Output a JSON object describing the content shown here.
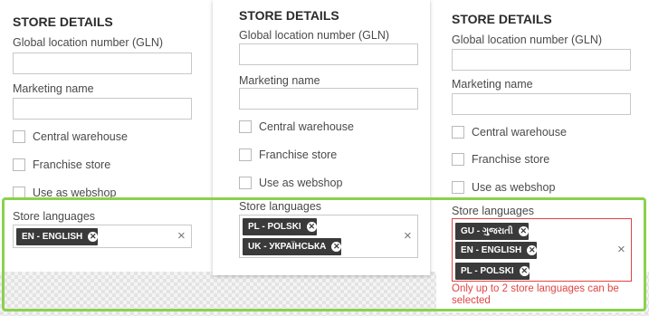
{
  "panels": [
    {
      "title": "STORE DETAILS",
      "gln_label": "Global location number (GLN)",
      "gln_value": "",
      "marketing_label": "Marketing name",
      "marketing_value": "",
      "checkboxes": [
        "Central warehouse",
        "Franchise store",
        "Use as webshop"
      ],
      "languages_label": "Store languages",
      "tags": [
        "EN - ENGLISH"
      ],
      "clear_icon": "×"
    },
    {
      "title": "STORE DETAILS",
      "gln_label": "Global location number (GLN)",
      "gln_value": "",
      "marketing_label": "Marketing name",
      "marketing_value": "",
      "checkboxes": [
        "Central warehouse",
        "Franchise store",
        "Use as webshop"
      ],
      "languages_label": "Store languages",
      "tags": [
        "PL - POLSKI",
        "UK - УКРАЇНСЬКА"
      ],
      "clear_icon": "×"
    },
    {
      "title": "STORE DETAILS",
      "gln_label": "Global location number (GLN)",
      "gln_value": "",
      "marketing_label": "Marketing name",
      "marketing_value": "",
      "checkboxes": [
        "Central warehouse",
        "Franchise store",
        "Use as webshop"
      ],
      "languages_label": "Store languages",
      "tags": [
        "GU - ગુજરાતી",
        "EN - ENGLISH",
        "PL - POLSKI"
      ],
      "clear_icon": "×",
      "error": "Only up to 2 store languages can be selected"
    }
  ],
  "tag_remove_icon": "✕",
  "colors": {
    "highlight": "#8bd14e",
    "error": "#e04545",
    "tag_bg": "#3a3a3a"
  }
}
